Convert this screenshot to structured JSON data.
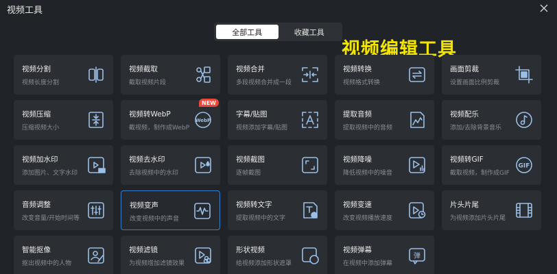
{
  "window": {
    "title": "视频工具"
  },
  "tabs": [
    {
      "label": "全部工具",
      "active": true
    },
    {
      "label": "收藏工具",
      "active": false
    }
  ],
  "watermark": "视频编辑工具",
  "tools": [
    {
      "title": "视频分割",
      "desc": "视频长度分割",
      "icon": "split-icon"
    },
    {
      "title": "视频截取",
      "desc": "截取视频片段",
      "icon": "scissors-icon"
    },
    {
      "title": "视频合并",
      "desc": "多段视频合并成一段",
      "icon": "merge-icon"
    },
    {
      "title": "视频转换",
      "desc": "视频格式转换",
      "icon": "convert-icon"
    },
    {
      "title": "画面剪裁",
      "desc": "设置画面比例剪裁",
      "icon": "crop-icon"
    },
    {
      "title": "视频压缩",
      "desc": "压缩视频大小",
      "icon": "compress-icon"
    },
    {
      "title": "视频转WebP",
      "desc": "截视频，制作成WebP",
      "icon": "webp-icon",
      "badge": "NEW"
    },
    {
      "title": "字幕/贴图",
      "desc": "视频添加字幕/贴图",
      "icon": "text-box-icon"
    },
    {
      "title": "提取音频",
      "desc": "提取视频中的音频",
      "icon": "audio-file-icon"
    },
    {
      "title": "视频配乐",
      "desc": "添加/去除背景音乐",
      "icon": "music-note-icon"
    },
    {
      "title": "视频加水印",
      "desc": "添加图片、文字水印",
      "icon": "stamp-icon"
    },
    {
      "title": "视频去水印",
      "desc": "去除视频中的水印",
      "icon": "drop-icon"
    },
    {
      "title": "视频截图",
      "desc": "逐帧截图",
      "icon": "screenshot-icon"
    },
    {
      "title": "视频降噪",
      "desc": "降低视频中的噪音",
      "icon": "denoise-icon"
    },
    {
      "title": "视频转GIF",
      "desc": "截取视频，制作成GIF",
      "icon": "gif-icon"
    },
    {
      "title": "音频调整",
      "desc": "改变音量/开始时间等",
      "icon": "equalizer-icon"
    },
    {
      "title": "视频变声",
      "desc": "改变视频中的声音",
      "icon": "waveform-icon",
      "selected": true
    },
    {
      "title": "视频转文字",
      "desc": "提取视频中的文字",
      "icon": "speech-to-text-icon"
    },
    {
      "title": "视频变速",
      "desc": "改变视频播放速度",
      "icon": "speed-clock-icon"
    },
    {
      "title": "片头片尾",
      "desc": "为视频添加片头片尾",
      "icon": "film-strip-icon"
    },
    {
      "title": "智能抠像",
      "desc": "抠出视频中的人物",
      "icon": "portrait-cutout-icon"
    },
    {
      "title": "视频滤镜",
      "desc": "为视频增加滤镜效果",
      "icon": "filter-icon"
    },
    {
      "title": "形状视频",
      "desc": "给视频添加形状遮罩",
      "icon": "shape-mask-icon"
    },
    {
      "title": "视频弹幕",
      "desc": "在视频中添加弹幕",
      "icon": "danmaku-icon"
    }
  ],
  "colors": {
    "background": "#202327",
    "card": "#2b2e33",
    "icon": "#9bbfe6",
    "selected_border": "#3a7fc9",
    "badge": "#e9493c",
    "watermark": "#f2e500"
  }
}
